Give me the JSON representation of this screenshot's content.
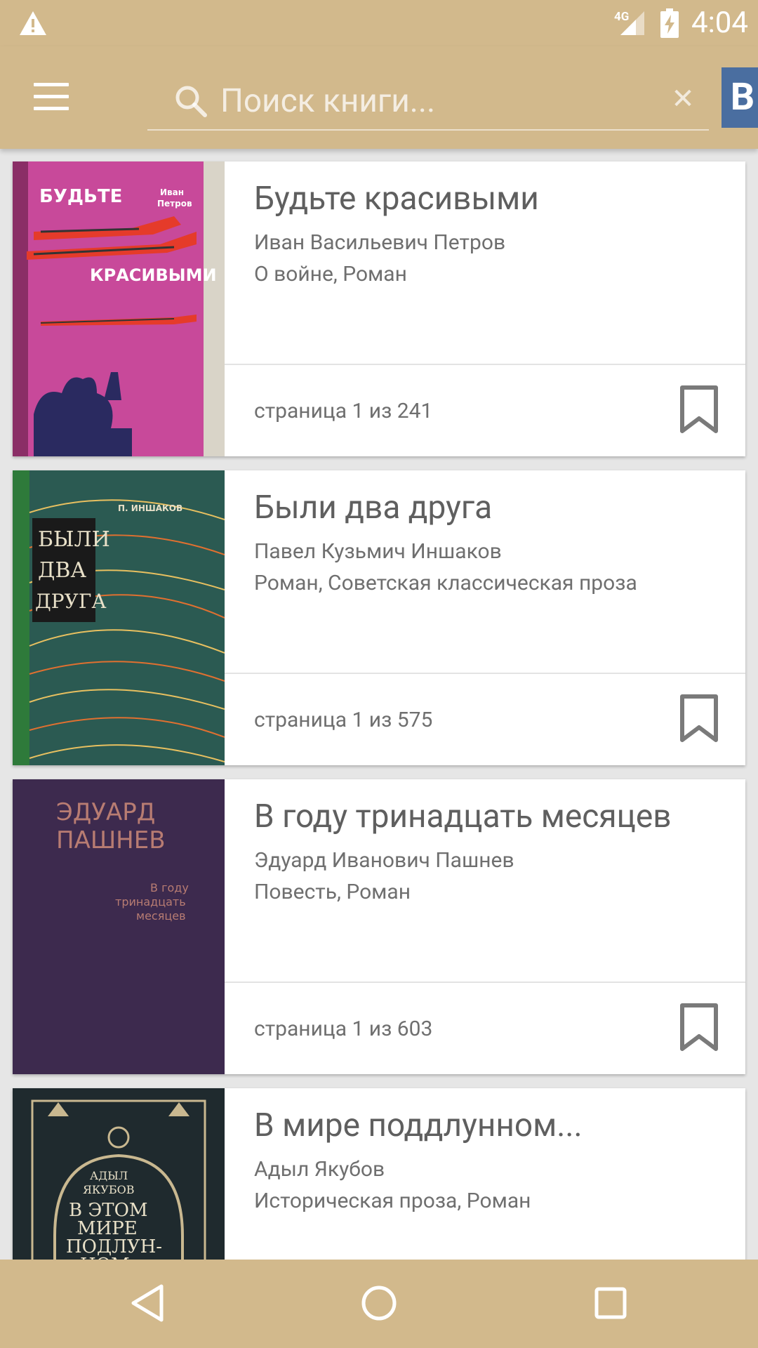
{
  "status_bar": {
    "network": "4G",
    "time": "4:04"
  },
  "toolbar": {
    "search_placeholder": "Поиск книги...",
    "clear_glyph": "✕",
    "vk_label": "В"
  },
  "books": [
    {
      "title": "Будьте красивыми",
      "author": "Иван Васильевич Петров",
      "genres": "О войне, Роман",
      "page": "страница 1 из 241",
      "cover": {
        "title": "БУДЬТЕ КРАСИВЫМИ",
        "author_short": "Иван Петров"
      }
    },
    {
      "title": "Были два друга",
      "author": "Павел Кузьмич Иншаков",
      "genres": "Роман, Советская классическая проза",
      "page": "страница 1 из 575",
      "cover": {
        "title": "БЫЛИ ДВА ДРУГА",
        "author_short": "П. ИНШАКОВ"
      }
    },
    {
      "title": "В году тринадцать месяцев",
      "author": "Эдуард Иванович Пашнев",
      "genres": "Повесть, Роман",
      "page": "страница 1 из 603",
      "cover": {
        "title": "В году тринадцать месяцев",
        "author_short": "ЭДУАРД ПАШНЕВ"
      }
    },
    {
      "title": "В мире поддлунном...",
      "author": "Адыл Якубов",
      "genres": "Историческая проза, Роман",
      "cover": {
        "title": "В ЭТОМ МИРЕ ПОДЛУН-НОМ...",
        "author_short": "АДЫЛ ЯКУБОВ"
      }
    }
  ],
  "colors": {
    "accent": "#d2b98c",
    "vk": "#4a6ea0"
  }
}
